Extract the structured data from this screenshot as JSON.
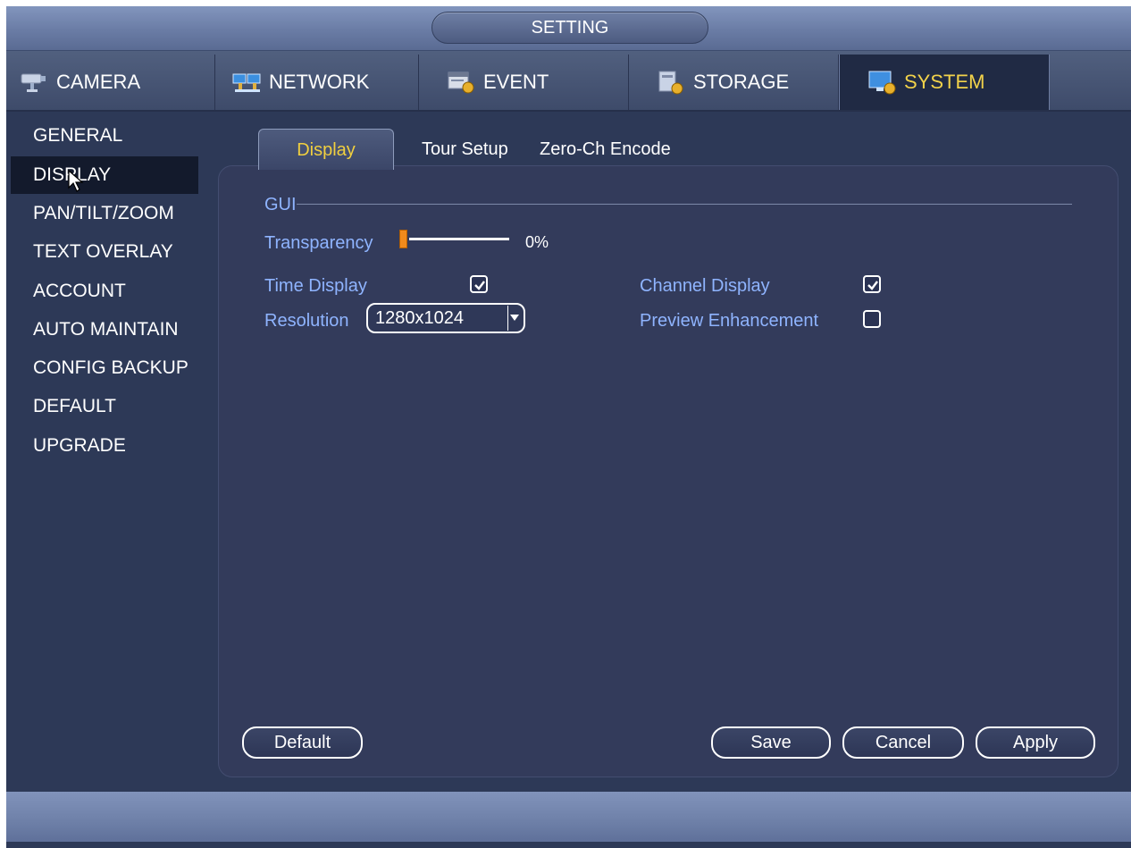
{
  "window": {
    "title": "SETTING"
  },
  "modules": [
    {
      "label": "CAMERA",
      "icon": "camera-icon",
      "active": false
    },
    {
      "label": "NETWORK",
      "icon": "network-icon",
      "active": false
    },
    {
      "label": "EVENT",
      "icon": "event-icon",
      "active": false
    },
    {
      "label": "STORAGE",
      "icon": "storage-icon",
      "active": false
    },
    {
      "label": "SYSTEM",
      "icon": "system-icon",
      "active": true
    }
  ],
  "sidebar": {
    "items": [
      {
        "label": "GENERAL"
      },
      {
        "label": "DISPLAY"
      },
      {
        "label": "PAN/TILT/ZOOM"
      },
      {
        "label": "TEXT OVERLAY"
      },
      {
        "label": "ACCOUNT"
      },
      {
        "label": "AUTO MAINTAIN"
      },
      {
        "label": "CONFIG BACKUP"
      },
      {
        "label": "DEFAULT"
      },
      {
        "label": "UPGRADE"
      }
    ],
    "selected": "DISPLAY"
  },
  "subtabs": [
    {
      "label": "Display",
      "active": true
    },
    {
      "label": "Tour Setup",
      "active": false
    },
    {
      "label": "Zero-Ch Encode",
      "active": false
    }
  ],
  "gui": {
    "section_label": "GUI",
    "transparency_label": "Transparency",
    "transparency_value": "0%",
    "transparency_level": 0,
    "time_display_label": "Time Display",
    "time_display_checked": true,
    "channel_display_label": "Channel Display",
    "channel_display_checked": true,
    "resolution_label": "Resolution",
    "resolution_value": "1280x1024",
    "preview_enhancement_label": "Preview Enhancement",
    "preview_enhancement_checked": false
  },
  "buttons": {
    "default_label": "Default",
    "save_label": "Save",
    "cancel_label": "Cancel",
    "apply_label": "Apply"
  },
  "colors": {
    "accent_yellow": "#f0cf3f",
    "label_blue": "#8fb4ff",
    "slider_orange": "#f08a1c",
    "panel_bg": "#333b5b"
  }
}
